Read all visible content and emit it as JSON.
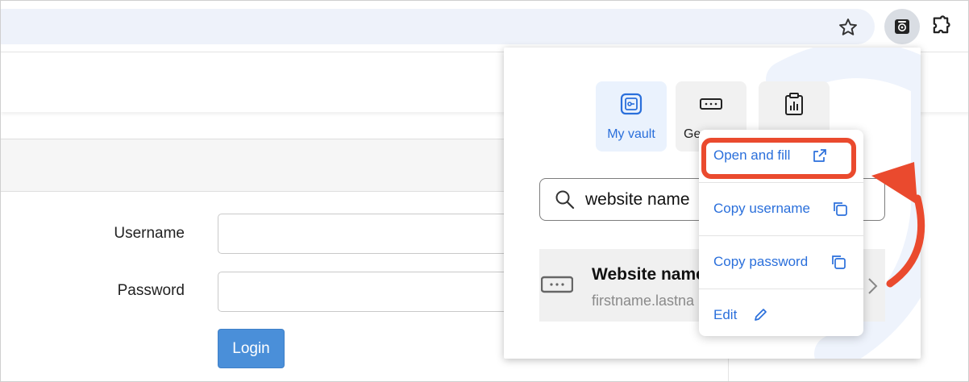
{
  "browser": {
    "icons": [
      "star-icon",
      "password-manager-extension-icon",
      "puzzle-icon"
    ]
  },
  "page": {
    "username_label": "Username",
    "password_label": "Password",
    "login_label": "Login"
  },
  "popup": {
    "tabs": [
      {
        "label": "My vault",
        "icon": "vault-icon",
        "active": true
      },
      {
        "label": "Ge",
        "icon": "generator-icon",
        "active": false
      },
      {
        "label": "",
        "icon": "report-icon",
        "active": false
      }
    ],
    "search": {
      "value": "website name"
    },
    "item": {
      "title": "Website name",
      "subtitle": "firstname.lastna"
    }
  },
  "menu": {
    "items": [
      {
        "label": "Open and fill",
        "icon": "external-link-icon"
      },
      {
        "label": "Copy username",
        "icon": "copy-icon"
      },
      {
        "label": "Copy password",
        "icon": "copy-icon"
      },
      {
        "label": "Edit",
        "icon": "pencil-icon"
      }
    ]
  },
  "colors": {
    "accent": "#2a6fdb",
    "highlight": "#ea4a2e",
    "login_button": "#4a8fd9"
  }
}
